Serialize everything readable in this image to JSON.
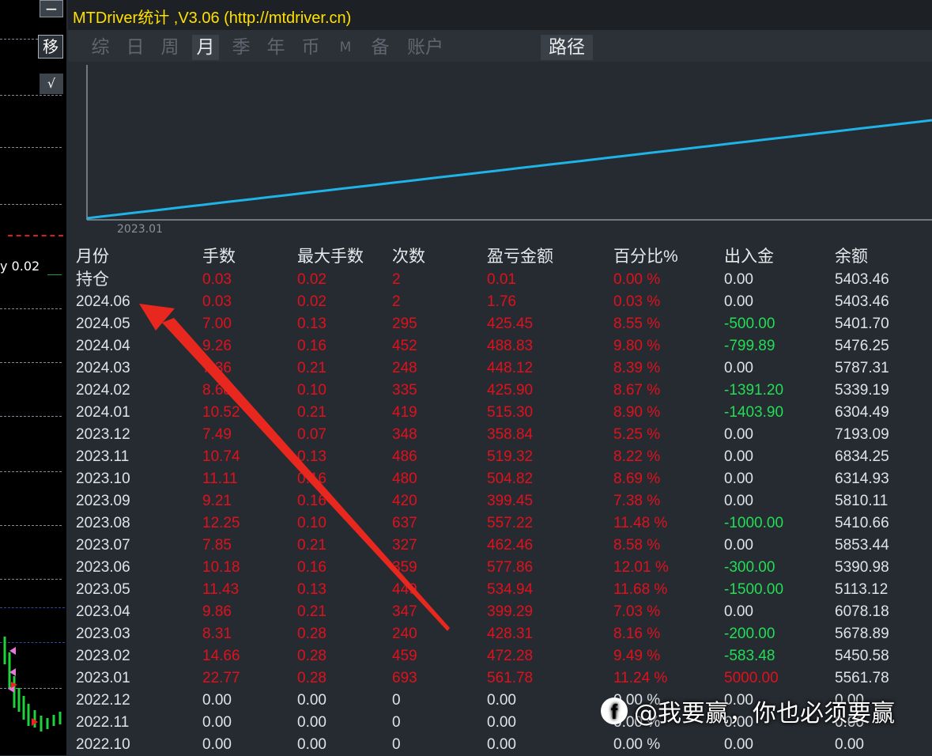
{
  "left_strip": {
    "minus_button": "−",
    "move_button": "移",
    "check_button": "√",
    "price_label": "y 0.02"
  },
  "window": {
    "title": "MTDriver统计 ,V3.06 (http://mtdriver.cn)"
  },
  "tabs": [
    {
      "label": "综",
      "active": false
    },
    {
      "label": "日",
      "active": false
    },
    {
      "label": "周",
      "active": false
    },
    {
      "label": "月",
      "active": true
    },
    {
      "label": "季",
      "active": false
    },
    {
      "label": "年",
      "active": false
    },
    {
      "label": "币",
      "active": false
    },
    {
      "label": "M",
      "active": false
    },
    {
      "label": "备",
      "active": false
    },
    {
      "label": "账户",
      "active": false
    },
    {
      "label": "路径",
      "active": false
    }
  ],
  "chart": {
    "x_start_label": "2023.01",
    "line_color": "#1fb3e6"
  },
  "table": {
    "headers": [
      "月份",
      "手数",
      "最大手数",
      "次数",
      "盈亏金额",
      "百分比%",
      "出入金",
      "余额"
    ],
    "rows": [
      [
        "持仓",
        "0.03",
        "0.02",
        "2",
        "0.01",
        "0.00 %",
        "0.00",
        "5403.46"
      ],
      [
        "2024.06",
        "0.03",
        "0.02",
        "2",
        "1.76",
        "0.03 %",
        "0.00",
        "5403.46"
      ],
      [
        "2024.05",
        "7.00",
        "0.13",
        "295",
        "425.45",
        "8.55 %",
        "-500.00",
        "5401.70"
      ],
      [
        "2024.04",
        "9.26",
        "0.16",
        "452",
        "488.83",
        "9.80 %",
        "-799.89",
        "5476.25"
      ],
      [
        "2024.03",
        "7.36",
        "0.21",
        "248",
        "448.12",
        "8.39 %",
        "0.00",
        "5787.31"
      ],
      [
        "2024.02",
        "8.68",
        "0.10",
        "335",
        "425.90",
        "8.67 %",
        "-1391.20",
        "5339.19"
      ],
      [
        "2024.01",
        "10.52",
        "0.21",
        "419",
        "515.30",
        "8.90 %",
        "-1403.90",
        "6304.49"
      ],
      [
        "2023.12",
        "7.49",
        "0.07",
        "348",
        "358.84",
        "5.25 %",
        "0.00",
        "7193.09"
      ],
      [
        "2023.11",
        "10.74",
        "0.13",
        "486",
        "519.32",
        "8.22 %",
        "0.00",
        "6834.25"
      ],
      [
        "2023.10",
        "11.11",
        "0.16",
        "480",
        "504.82",
        "8.69 %",
        "0.00",
        "6314.93"
      ],
      [
        "2023.09",
        "9.21",
        "0.16",
        "420",
        "399.45",
        "7.38 %",
        "0.00",
        "5810.11"
      ],
      [
        "2023.08",
        "12.25",
        "0.10",
        "637",
        "557.22",
        "11.48 %",
        "-1000.00",
        "5410.66"
      ],
      [
        "2023.07",
        "7.85",
        "0.21",
        "327",
        "462.46",
        "8.58 %",
        "0.00",
        "5853.44"
      ],
      [
        "2023.06",
        "10.18",
        "0.16",
        "359",
        "577.86",
        "12.01 %",
        "-300.00",
        "5390.98"
      ],
      [
        "2023.05",
        "11.43",
        "0.13",
        "449",
        "534.94",
        "11.68 %",
        "-1500.00",
        "5113.12"
      ],
      [
        "2023.04",
        "9.86",
        "0.21",
        "347",
        "399.29",
        "7.03 %",
        "0.00",
        "6078.18"
      ],
      [
        "2023.03",
        "8.31",
        "0.28",
        "240",
        "428.31",
        "8.16 %",
        "-200.00",
        "5678.89"
      ],
      [
        "2023.02",
        "14.66",
        "0.28",
        "459",
        "472.28",
        "9.49 %",
        "-583.48",
        "5450.58"
      ],
      [
        "2023.01",
        "22.77",
        "0.28",
        "693",
        "561.78",
        "11.24 %",
        "5000.00",
        "5561.78"
      ],
      [
        "2022.12",
        "0.00",
        "0.00",
        "0",
        "0.00",
        "0.00 %",
        "0.00",
        "0.00"
      ],
      [
        "2022.11",
        "0.00",
        "0.00",
        "0",
        "0.00",
        "0.00 %",
        "0.00",
        "0.00"
      ],
      [
        "2022.10",
        "0.00",
        "0.00",
        "0",
        "0.00",
        "0.00 %",
        "0.00",
        "0.00"
      ]
    ]
  },
  "watermark": {
    "logo": "f",
    "text": "@我要赢，你也必须要赢"
  },
  "colors": {
    "positive_red": "#e0111c",
    "negative_green": "#22dd55",
    "title_yellow": "#ffe100",
    "annotation_arrow": "#e8271f"
  }
}
